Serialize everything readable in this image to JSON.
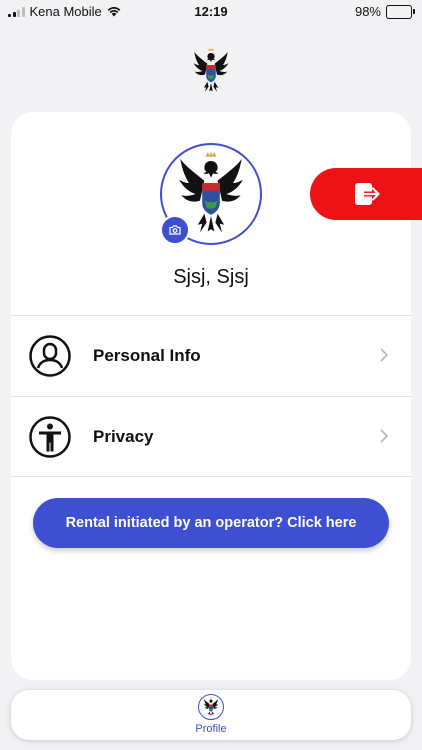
{
  "status_bar": {
    "carrier": "Kena Mobile",
    "time": "12:19",
    "battery": "98%"
  },
  "profile": {
    "name": "Sjsj, Sjsj"
  },
  "menu": {
    "items": [
      {
        "label": "Personal Info",
        "icon": "user-circle-icon"
      },
      {
        "label": "Privacy",
        "icon": "accessibility-icon"
      }
    ]
  },
  "cta": {
    "label": "Rental initiated by an operator? Click here"
  },
  "tabbar": {
    "items": [
      {
        "label": "Profile",
        "icon": "coat-of-arms-icon"
      }
    ]
  },
  "colors": {
    "accent": "#3f4fd1",
    "logout": "#ee1116"
  }
}
